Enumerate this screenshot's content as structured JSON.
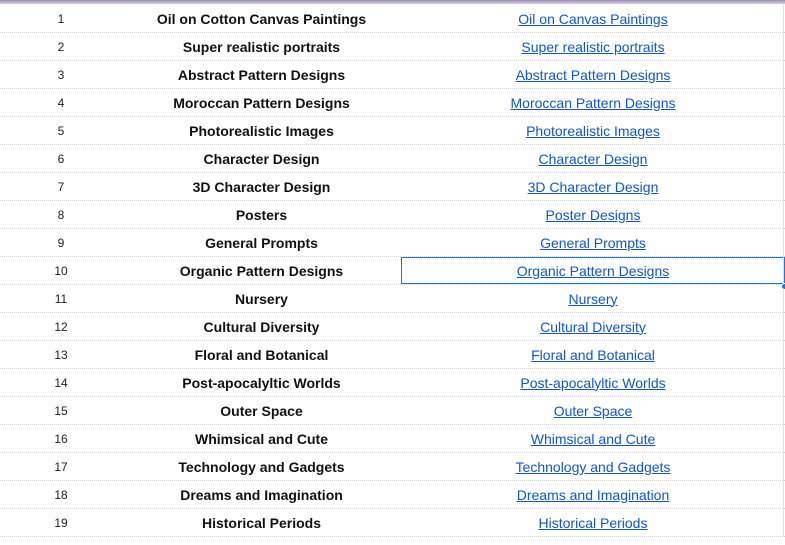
{
  "rows": [
    {
      "num": "1",
      "title": "Oil on Cotton Canvas Paintings",
      "link": "Oil on Canvas Paintings"
    },
    {
      "num": "2",
      "title": "Super realistic portraits",
      "link": "Super realistic portraits"
    },
    {
      "num": "3",
      "title": "Abstract Pattern Designs",
      "link": "Abstract Pattern Designs"
    },
    {
      "num": "4",
      "title": "Moroccan Pattern Designs",
      "link": "Moroccan Pattern Designs"
    },
    {
      "num": "5",
      "title": "Photorealistic Images",
      "link": "Photorealistic Images"
    },
    {
      "num": "6",
      "title": "Character Design",
      "link": "Character Design"
    },
    {
      "num": "7",
      "title": "3D Character Design",
      "link": "3D Character Design"
    },
    {
      "num": "8",
      "title": "Posters",
      "link": "Poster Designs"
    },
    {
      "num": "9",
      "title": "General Prompts",
      "link": "General Prompts"
    },
    {
      "num": "10",
      "title": "Organic Pattern Designs",
      "link": "Organic Pattern Designs"
    },
    {
      "num": "11",
      "title": "Nursery",
      "link": "Nursery"
    },
    {
      "num": "12",
      "title": "Cultural Diversity",
      "link": "Cultural Diversity"
    },
    {
      "num": "13",
      "title": "Floral and Botanical",
      "link": "Floral and Botanical"
    },
    {
      "num": "14",
      "title": "Post-apocalyltic Worlds",
      "link": "Post-apocalyltic Worlds"
    },
    {
      "num": "15",
      "title": "Outer Space",
      "link": "Outer Space"
    },
    {
      "num": "16",
      "title": "Whimsical and Cute",
      "link": "Whimsical and Cute"
    },
    {
      "num": "17",
      "title": "Technology and Gadgets",
      "link": "Technology and Gadgets"
    },
    {
      "num": "18",
      "title": "Dreams and Imagination",
      "link": "Dreams and Imagination"
    },
    {
      "num": "19",
      "title": "Historical Periods",
      "link": "Historical Periods"
    }
  ],
  "selected_row": 10,
  "colors": {
    "link": "#1155cc",
    "selection": "#1a73e8",
    "gridline": "#d4d4d4"
  }
}
